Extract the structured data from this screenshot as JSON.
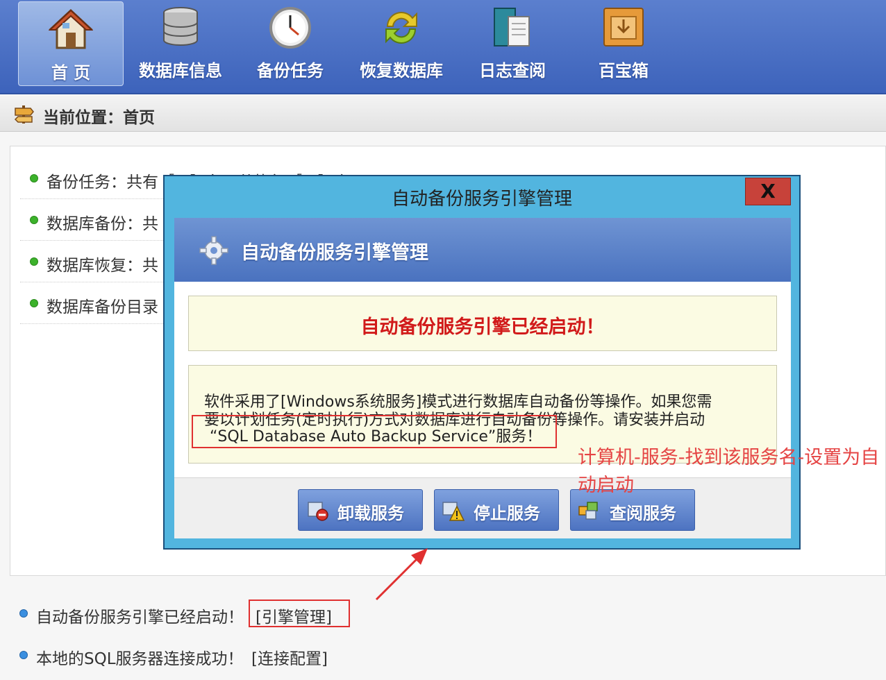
{
  "toolbar": {
    "items": [
      {
        "label": "首 页",
        "icon": "home-icon"
      },
      {
        "label": "数据库信息",
        "icon": "database-icon"
      },
      {
        "label": "备份任务",
        "icon": "clock-icon"
      },
      {
        "label": "恢复数据库",
        "icon": "refresh-icon"
      },
      {
        "label": "日志查阅",
        "icon": "book-icon"
      },
      {
        "label": "百宝箱",
        "icon": "box-icon"
      }
    ],
    "active_index": 0
  },
  "location": {
    "label": "当前位置：首页",
    "icon": "signpost-icon"
  },
  "stats": [
    {
      "text": "备份任务：共有［０］条，共执行［０］次"
    },
    {
      "text": "数据库备份：共"
    },
    {
      "text": "数据库恢复：共"
    },
    {
      "text": "数据库备份目录"
    }
  ],
  "dialog": {
    "title": "自动备份服务引擎管理",
    "close_label": "X",
    "header_title": "自动备份服务引擎管理",
    "header_icon": "gear-icon",
    "status_message": "自动备份服务引擎已经启动！",
    "info_lines": [
      "软件采用了[Windows系统服务]模式进行数据库自动备份等操作。如果您需",
      "要以计划任务(定时执行)方式对数据库进行自动备份等操作。请安装并启动",
      "“SQL Database Auto Backup Service”服务！"
    ],
    "buttons": [
      {
        "label": "卸载服务",
        "icon": "uninstall-icon"
      },
      {
        "label": "停止服务",
        "icon": "warning-icon"
      },
      {
        "label": "查阅服务",
        "icon": "view-icon"
      }
    ]
  },
  "bottom_status": [
    {
      "text": "自动备份服务引擎已经启动！",
      "link": "[引擎管理]"
    },
    {
      "text": "本地的SQL服务器连接成功！",
      "link": "[连接配置]"
    }
  ],
  "annotation": {
    "note": "计算机-服务-找到该服务名-设置为自动启动",
    "color": "#e54444"
  }
}
